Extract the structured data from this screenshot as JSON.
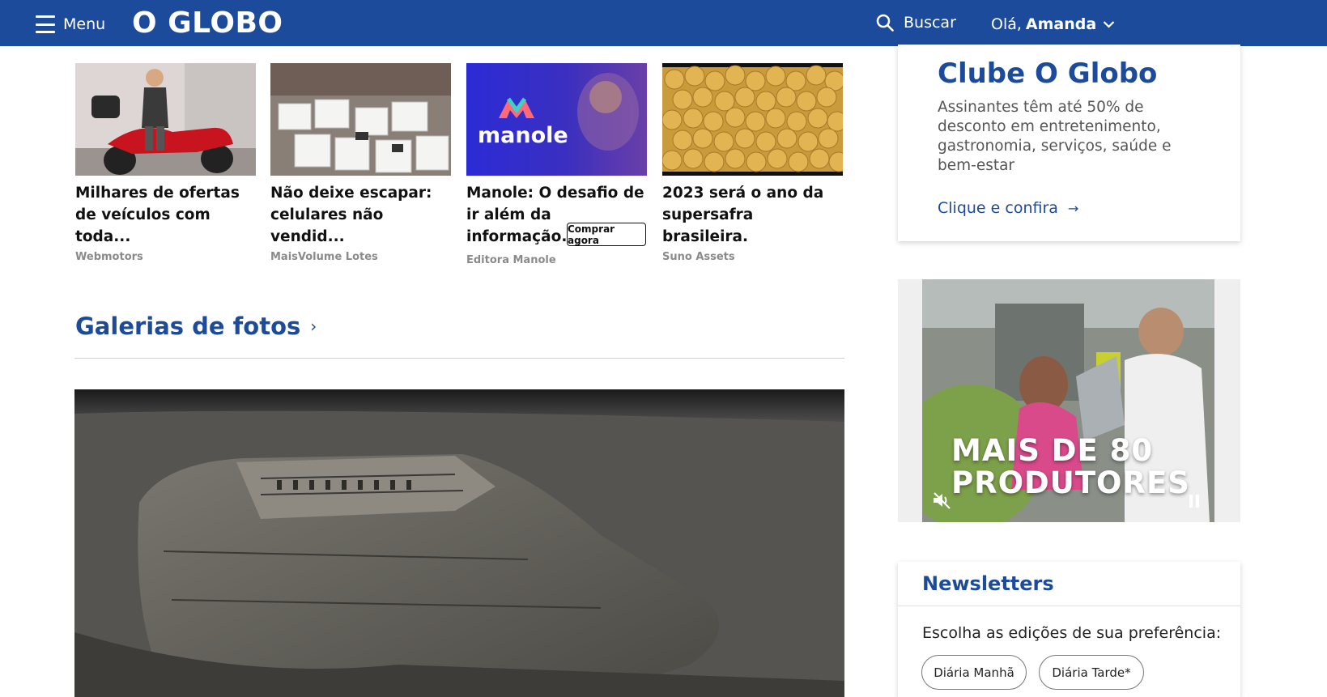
{
  "header": {
    "menu_label": "Menu",
    "logo": "O GLOBO",
    "search_label": "Buscar",
    "greeting": "Olá,",
    "user_name": "Amanda"
  },
  "ads": [
    {
      "title": "Milhares de ofertas de veículos com toda...",
      "source": "Webmotors"
    },
    {
      "title": "Não deixe escapar: celulares não vendid...",
      "source": "MaisVolume Lotes"
    },
    {
      "title": "Manole: O desafio de ir além da informação.",
      "source": "Editora Manole",
      "logo_text": "manole",
      "cta": "Comprar agora"
    },
    {
      "title": "2023 será o ano da supersafra brasileira.",
      "source": "Suno Assets"
    }
  ],
  "gallery": {
    "title": "Galerias de fotos"
  },
  "clube": {
    "title": "Clube O Globo",
    "description": "Assinantes têm até 50% de desconto em entretenimento, gastronomia, serviços, saúde e bem-estar",
    "link": "Clique e confira"
  },
  "video_ad": {
    "overlay_line1": "MAIS DE 80",
    "overlay_line2": "PRODUTORES"
  },
  "newsletters": {
    "title": "Newsletters",
    "description": "Escolha as edições de sua preferência:",
    "options": [
      "Diária Manhã",
      "Diária Tarde*"
    ]
  },
  "colors": {
    "brand_blue": "#1d4b9b"
  }
}
